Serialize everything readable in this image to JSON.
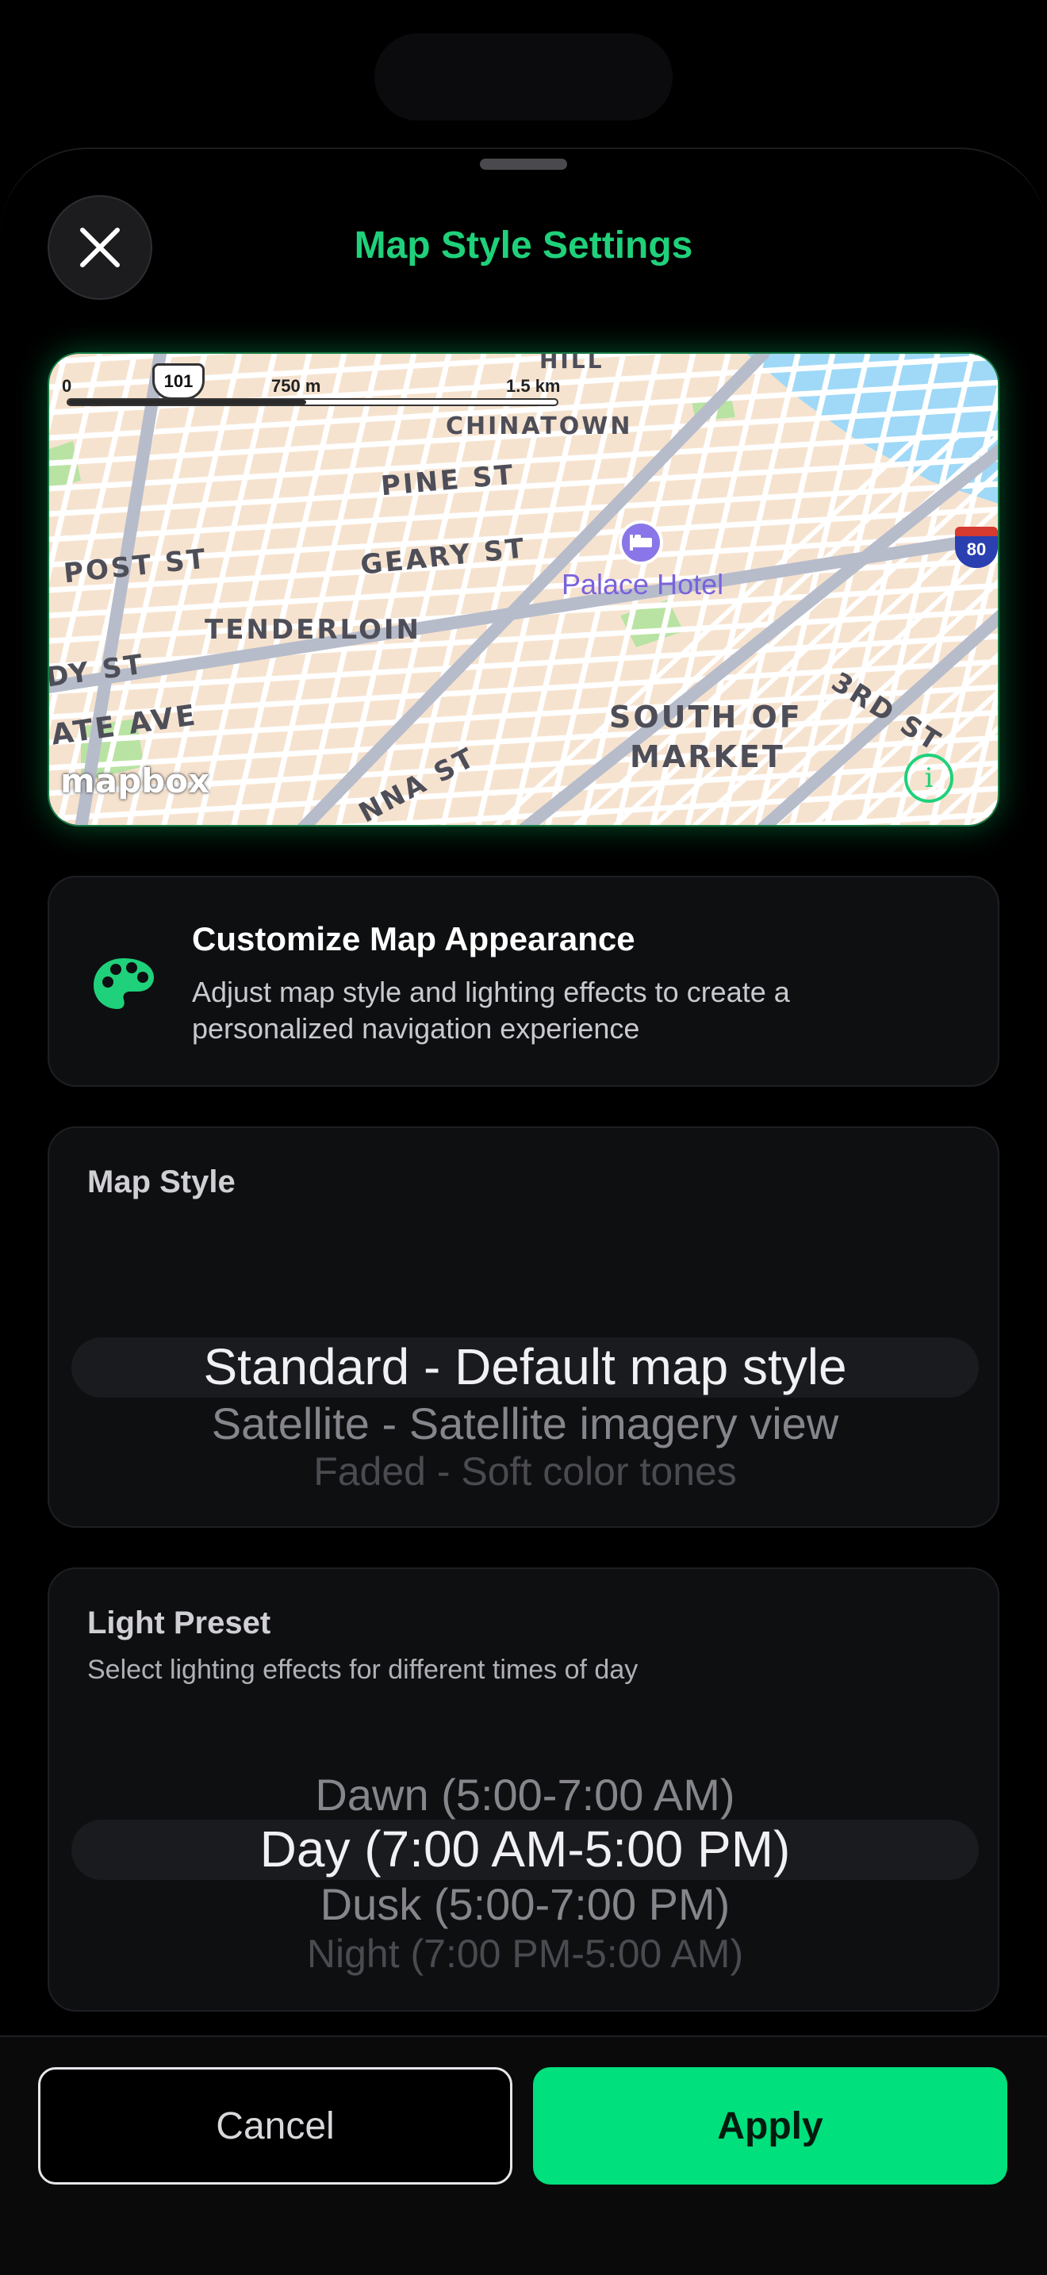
{
  "header": {
    "title": "Map Style Settings",
    "close_icon": "close-icon"
  },
  "map_preview": {
    "scale": {
      "start": "0",
      "mid": "750 m",
      "end": "1.5 km"
    },
    "highway_shields": [
      "101",
      "80"
    ],
    "labels": {
      "hill": "HILL",
      "chinatown": "CHINATOWN",
      "pine": "PINE ST",
      "post": "POST ST",
      "geary": "GEARY ST",
      "tenderloin": "TENDERLOIN",
      "dy": "DY ST",
      "ate": "ATE AVE",
      "soma1": "SOUTH OF",
      "soma2": "MARKET",
      "third": "3RD ST",
      "nna": "NNA ST",
      "hotel": "Palace Hotel"
    },
    "logo": "mapbox",
    "info_icon": "info-icon",
    "hotel_icon": "bed-icon",
    "colors": {
      "water": "#9fd9f7",
      "park": "#b9e3a3",
      "block": "#f6e3cf",
      "street": "#ffffff",
      "major_street": "#b7bccb"
    }
  },
  "info_card": {
    "icon": "palette-icon",
    "title": "Customize Map Appearance",
    "description": "Adjust map style and lighting effects to create a personalized navigation experience"
  },
  "map_style": {
    "label": "Map Style",
    "selected": "Standard - Default map style",
    "next_1": "Satellite - Satellite imagery view",
    "next_2": "Faded - Soft color tones"
  },
  "light_preset": {
    "label": "Light Preset",
    "subtitle": "Select lighting effects for different times of day",
    "prev_1": "Dawn (5:00-7:00 AM)",
    "selected": "Day (7:00 AM-5:00 PM)",
    "next_1": "Dusk (5:00-7:00 PM)",
    "next_2": "Night (7:00 PM-5:00 AM)"
  },
  "footer": {
    "cancel_label": "Cancel",
    "apply_label": "Apply"
  },
  "colors": {
    "accent": "#00e07c",
    "title": "#1fd17a",
    "background": "#000000"
  }
}
